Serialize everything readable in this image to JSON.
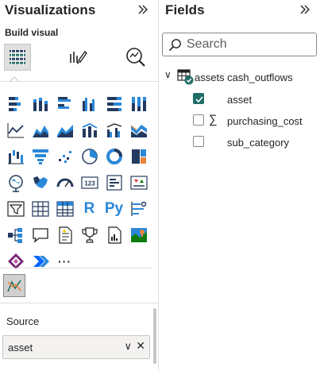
{
  "visualizations": {
    "title": "Visualizations",
    "collapse_icon": "double-chevron-right",
    "build_label": "Build visual",
    "tabs": [
      {
        "name": "build-visual",
        "icon": "chart-build-icon",
        "selected": true
      },
      {
        "name": "format-visual",
        "icon": "paintbrush-icon",
        "selected": false
      },
      {
        "name": "analytics",
        "icon": "magnifier-chart-icon",
        "selected": false
      }
    ],
    "gallery_text": {
      "r": "R",
      "py": "Py",
      "more": "···"
    },
    "well": {
      "label": "Source",
      "field": "asset",
      "chevron": "∨",
      "remove": "✕"
    }
  },
  "fields": {
    "title": "Fields",
    "collapse_icon": "double-chevron-right",
    "search": {
      "placeholder": "Search",
      "value": ""
    },
    "table": {
      "name": "assets cash_outflows",
      "expanded": true,
      "chevron": "∨"
    },
    "items": [
      {
        "name": "asset",
        "checked": true,
        "aggregated": false
      },
      {
        "name": "purchasing_cost",
        "checked": false,
        "aggregated": true
      },
      {
        "name": "sub_category",
        "checked": false,
        "aggregated": false
      }
    ],
    "sigma": "∑"
  },
  "colors": {
    "accent_teal": "#1f6f67",
    "viz_blue": "#2b88d8",
    "dark_blue": "#243a5e",
    "yellow": "#f2c811",
    "orange": "#e8833a"
  }
}
